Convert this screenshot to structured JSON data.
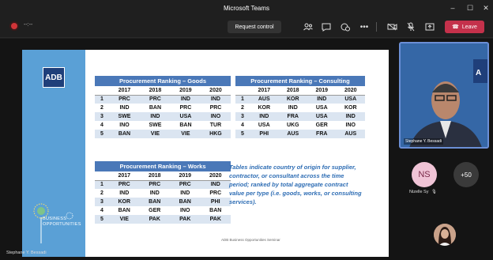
{
  "window": {
    "title": "Microsoft Teams",
    "minimize": "–",
    "maximize": "☐",
    "close": "✕"
  },
  "toolbar": {
    "timer": "--:--",
    "request_control": "Request control",
    "leave": "Leave",
    "icons": [
      "people-icon",
      "chat-icon",
      "reactions-icon",
      "more-icon",
      "camera-off-icon",
      "mic-off-icon",
      "share-icon"
    ]
  },
  "slide": {
    "logo": "ADB",
    "brand": [
      "BUSINESS",
      "OPPORTUNITIES"
    ],
    "footer": "ADB Business Opportunities Seminar",
    "note": "Tables indicate country of origin for supplier, contractor, or consultant across the time period; ranked by total aggregate contract value per type (i.e. goods, works, or consulting services).",
    "goods": {
      "title": "Procurement Ranking – Goods",
      "years": [
        "2017",
        "2018",
        "2019",
        "2020"
      ],
      "rows": [
        [
          "1",
          "PRC",
          "PRC",
          "IND",
          "IND"
        ],
        [
          "2",
          "IND",
          "BAN",
          "PRC",
          "PRC"
        ],
        [
          "3",
          "SWE",
          "IND",
          "USA",
          "INO"
        ],
        [
          "4",
          "INO",
          "SWE",
          "BAN",
          "TUR"
        ],
        [
          "5",
          "BAN",
          "VIE",
          "VIE",
          "HKG"
        ]
      ]
    },
    "consulting": {
      "title": "Procurement Ranking – Consulting",
      "years": [
        "2017",
        "2018",
        "2019",
        "2020"
      ],
      "rows": [
        [
          "1",
          "AUS",
          "KOR",
          "IND",
          "USA"
        ],
        [
          "2",
          "KOR",
          "IND",
          "USA",
          "KOR"
        ],
        [
          "3",
          "IND",
          "FRA",
          "USA",
          "IND"
        ],
        [
          "4",
          "USA",
          "UKG",
          "GER",
          "INO"
        ],
        [
          "5",
          "PHI",
          "AUS",
          "FRA",
          "AUS"
        ]
      ]
    },
    "works": {
      "title": "Procurement Ranking – Works",
      "years": [
        "2017",
        "2018",
        "2019",
        "2020"
      ],
      "rows": [
        [
          "1",
          "PRC",
          "PRC",
          "PRC",
          "IND"
        ],
        [
          "2",
          "IND",
          "IND",
          "IND",
          "PRC"
        ],
        [
          "3",
          "KOR",
          "BAN",
          "BAN",
          "PHI"
        ],
        [
          "4",
          "BAN",
          "GER",
          "INO",
          "BAN"
        ],
        [
          "5",
          "VIE",
          "PAK",
          "PAK",
          "PAK"
        ]
      ]
    }
  },
  "participants": {
    "speaker": "Stephane Y. Bessadi",
    "ns_initials": "NS",
    "ns_name": "Nizelle Sy",
    "more": "+50",
    "presenter_label": "Stephane Y. Bessadi"
  }
}
